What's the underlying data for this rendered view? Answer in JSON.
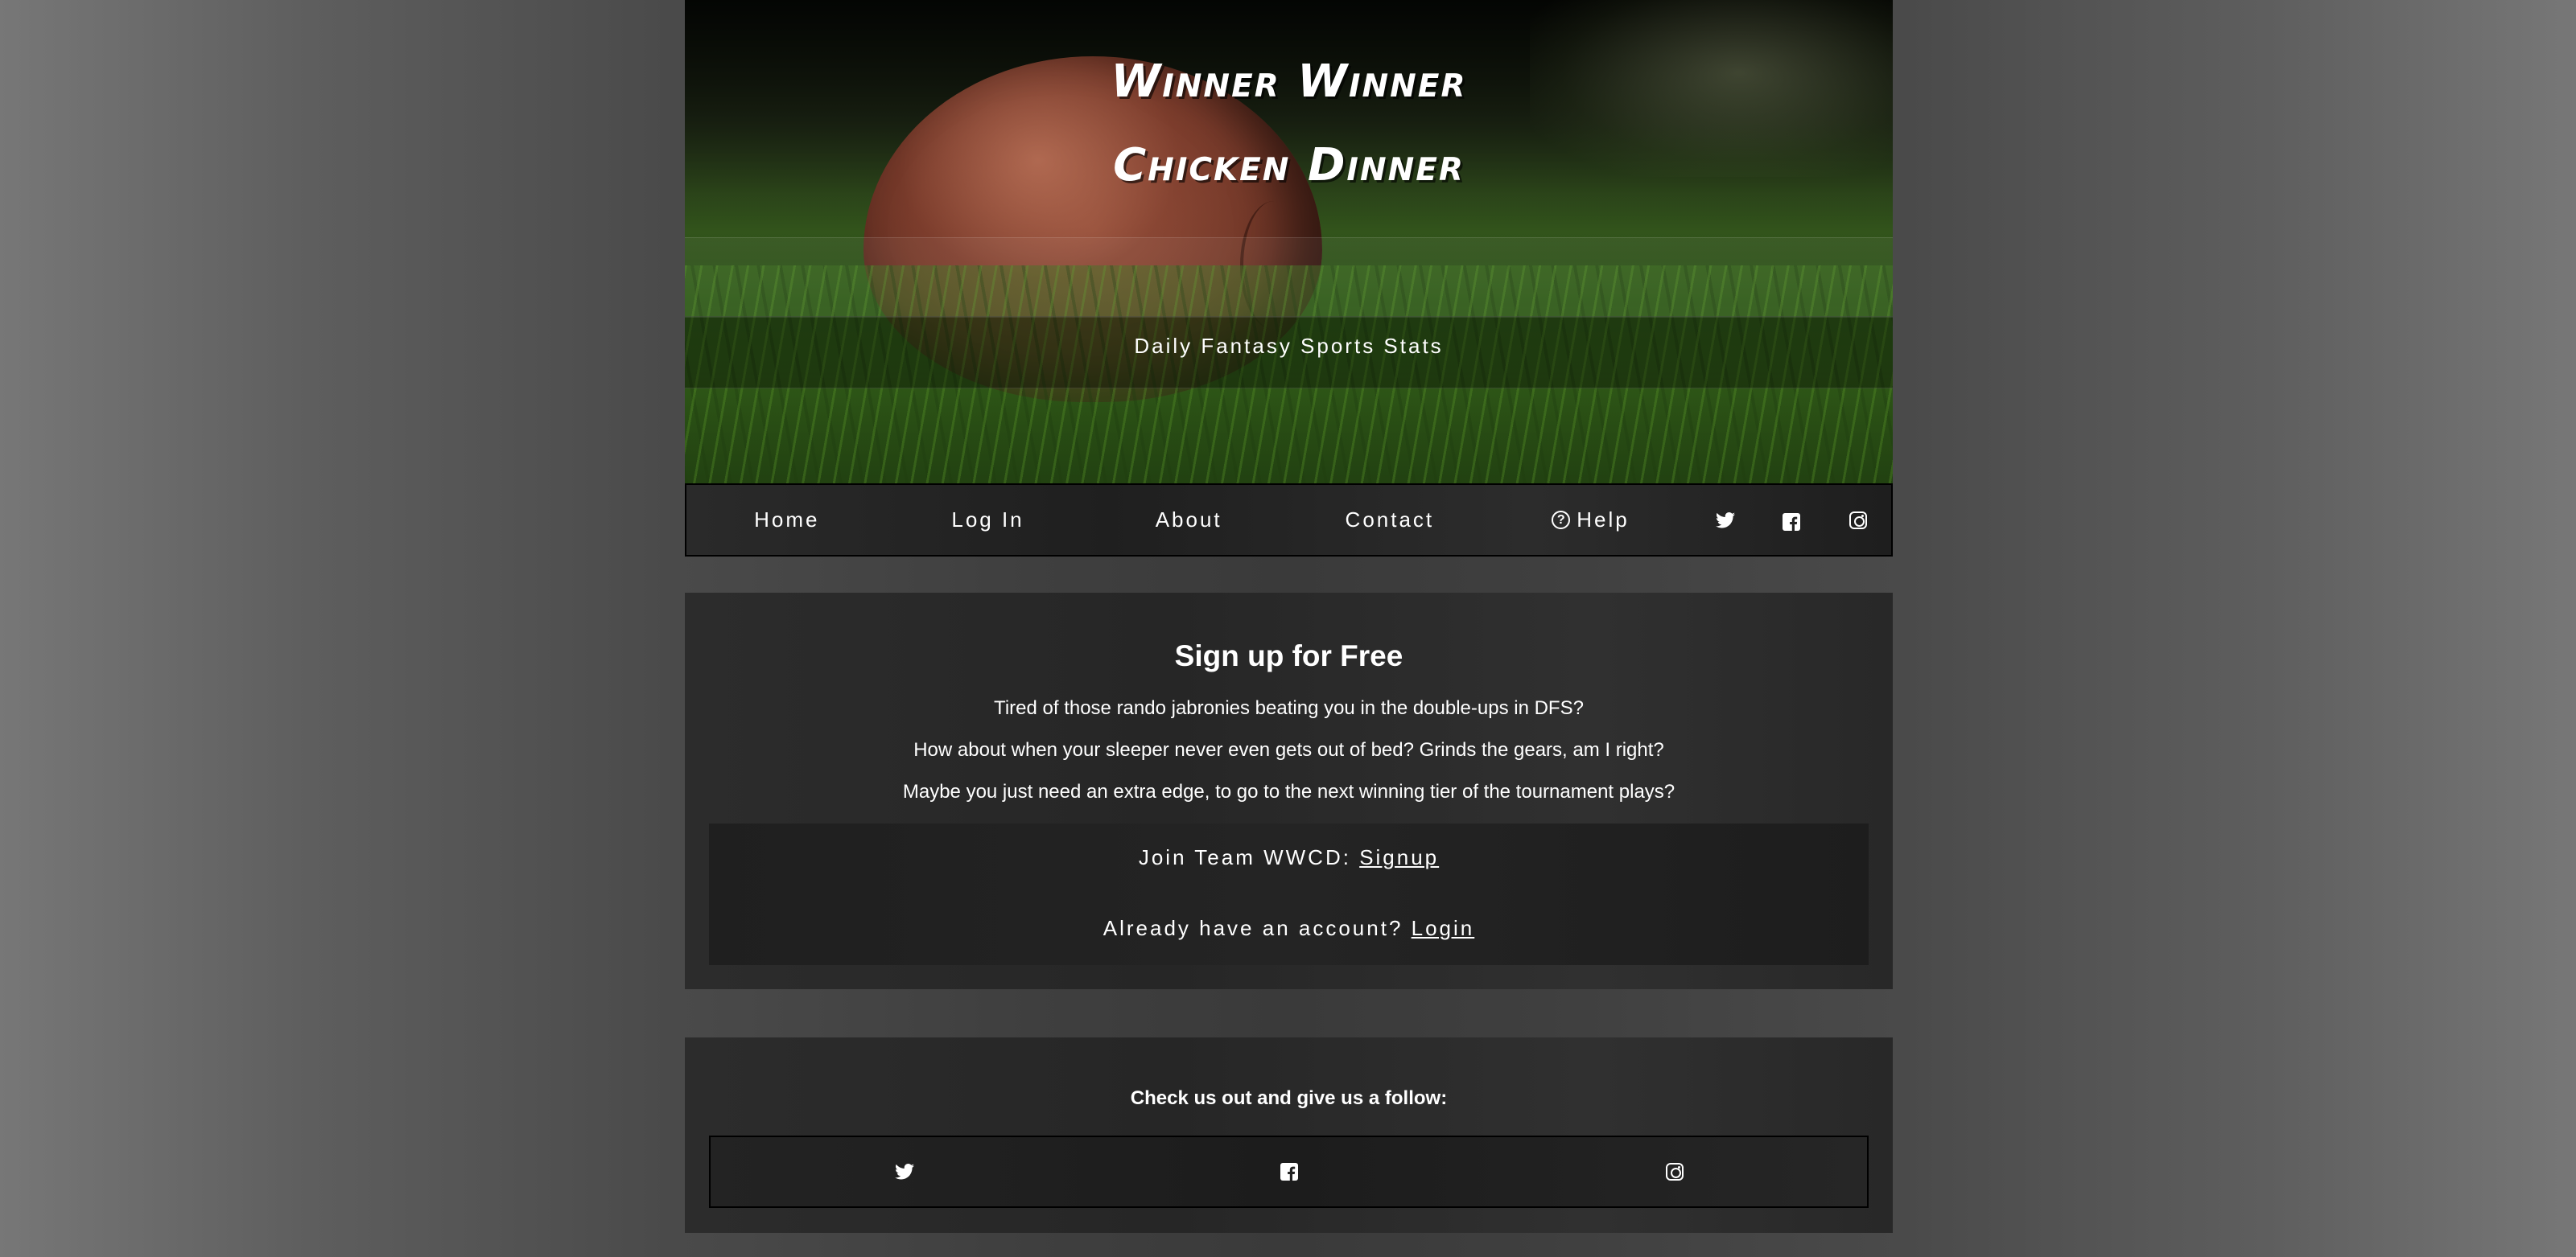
{
  "hero": {
    "title_line1": "Winner Winner",
    "title_line2": "Chicken Dinner",
    "tagline": "Daily Fantasy Sports Stats"
  },
  "nav": {
    "items": [
      {
        "label": "Home"
      },
      {
        "label": "Log In"
      },
      {
        "label": "About"
      },
      {
        "label": "Contact"
      },
      {
        "label": "Help",
        "icon": "question-circle-icon"
      }
    ],
    "social_icons": [
      "twitter-icon",
      "facebook-icon",
      "instagram-icon"
    ]
  },
  "signup": {
    "title": "Sign up for Free",
    "lines": [
      "Tired of those rando jabronies beating you in the double-ups in DFS?",
      "How about when your sleeper never even gets out of bed? Grinds the gears, am I right?",
      "Maybe you just need an extra edge, to go to the next winning tier of the tournament plays?"
    ],
    "join_prefix": "Join Team WWCD: ",
    "join_link": "Signup",
    "login_prefix": "Already have an account? ",
    "login_link": "Login"
  },
  "follow": {
    "title": "Check us out and give us a follow:",
    "icons": [
      "twitter-icon",
      "facebook-icon",
      "instagram-icon"
    ]
  },
  "colors": {
    "text": "#ffffff",
    "card_bg": "#2a2a2a",
    "border": "#000000"
  }
}
